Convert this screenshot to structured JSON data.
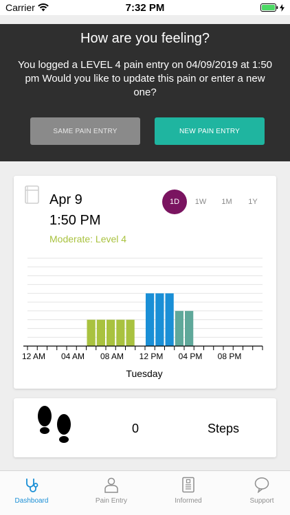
{
  "status": {
    "carrier": "Carrier",
    "time": "7:32 PM"
  },
  "prompt": {
    "title": "How are you feeling?",
    "message": "You logged a LEVEL 4 pain entry on 04/09/2019 at 1:50 pm Would you like to update this pain or enter a new one?",
    "same_label": "SAME PAIN ENTRY",
    "new_label": "NEW PAIN ENTRY"
  },
  "entry": {
    "date": "Apr 9",
    "time": "1:50 PM",
    "level": "Moderate: Level 4",
    "level_color": "#a9c23f"
  },
  "periods": [
    "1D",
    "1W",
    "1M",
    "1Y"
  ],
  "selected_period": "1D",
  "chart_data": {
    "type": "bar",
    "x_ticks": [
      "12 AM",
      "04 AM",
      "08 AM",
      "12 PM",
      "04 PM",
      "08 PM"
    ],
    "xlabel": "Tuesday",
    "x_range_hours": [
      0,
      24
    ],
    "series": [
      {
        "color": "#a9c23f",
        "bars": [
          {
            "hour": 6,
            "value": 3
          },
          {
            "hour": 7,
            "value": 3
          },
          {
            "hour": 8,
            "value": 3
          },
          {
            "hour": 9,
            "value": 3
          },
          {
            "hour": 10,
            "value": 3
          }
        ]
      },
      {
        "color": "#1a8fd6",
        "bars": [
          {
            "hour": 12,
            "value": 6
          },
          {
            "hour": 13,
            "value": 6
          },
          {
            "hour": 14,
            "value": 6
          }
        ]
      },
      {
        "color": "#5fa89a",
        "bars": [
          {
            "hour": 15,
            "value": 4
          },
          {
            "hour": 16,
            "value": 4
          }
        ]
      }
    ],
    "ylim": [
      0,
      10
    ],
    "grid": true
  },
  "steps": {
    "value": "0",
    "label": "Steps"
  },
  "tabs": [
    {
      "label": "Dashboard",
      "icon": "stethoscope-icon",
      "active": true
    },
    {
      "label": "Pain Entry",
      "icon": "person-icon",
      "active": false
    },
    {
      "label": "Informed",
      "icon": "document-icon",
      "active": false
    },
    {
      "label": "Support",
      "icon": "chat-bubble-icon",
      "active": false
    }
  ],
  "colors": {
    "accent": "#1fb5a0",
    "selected_period": "#7a1460",
    "tab_active": "#1a8fd6"
  }
}
